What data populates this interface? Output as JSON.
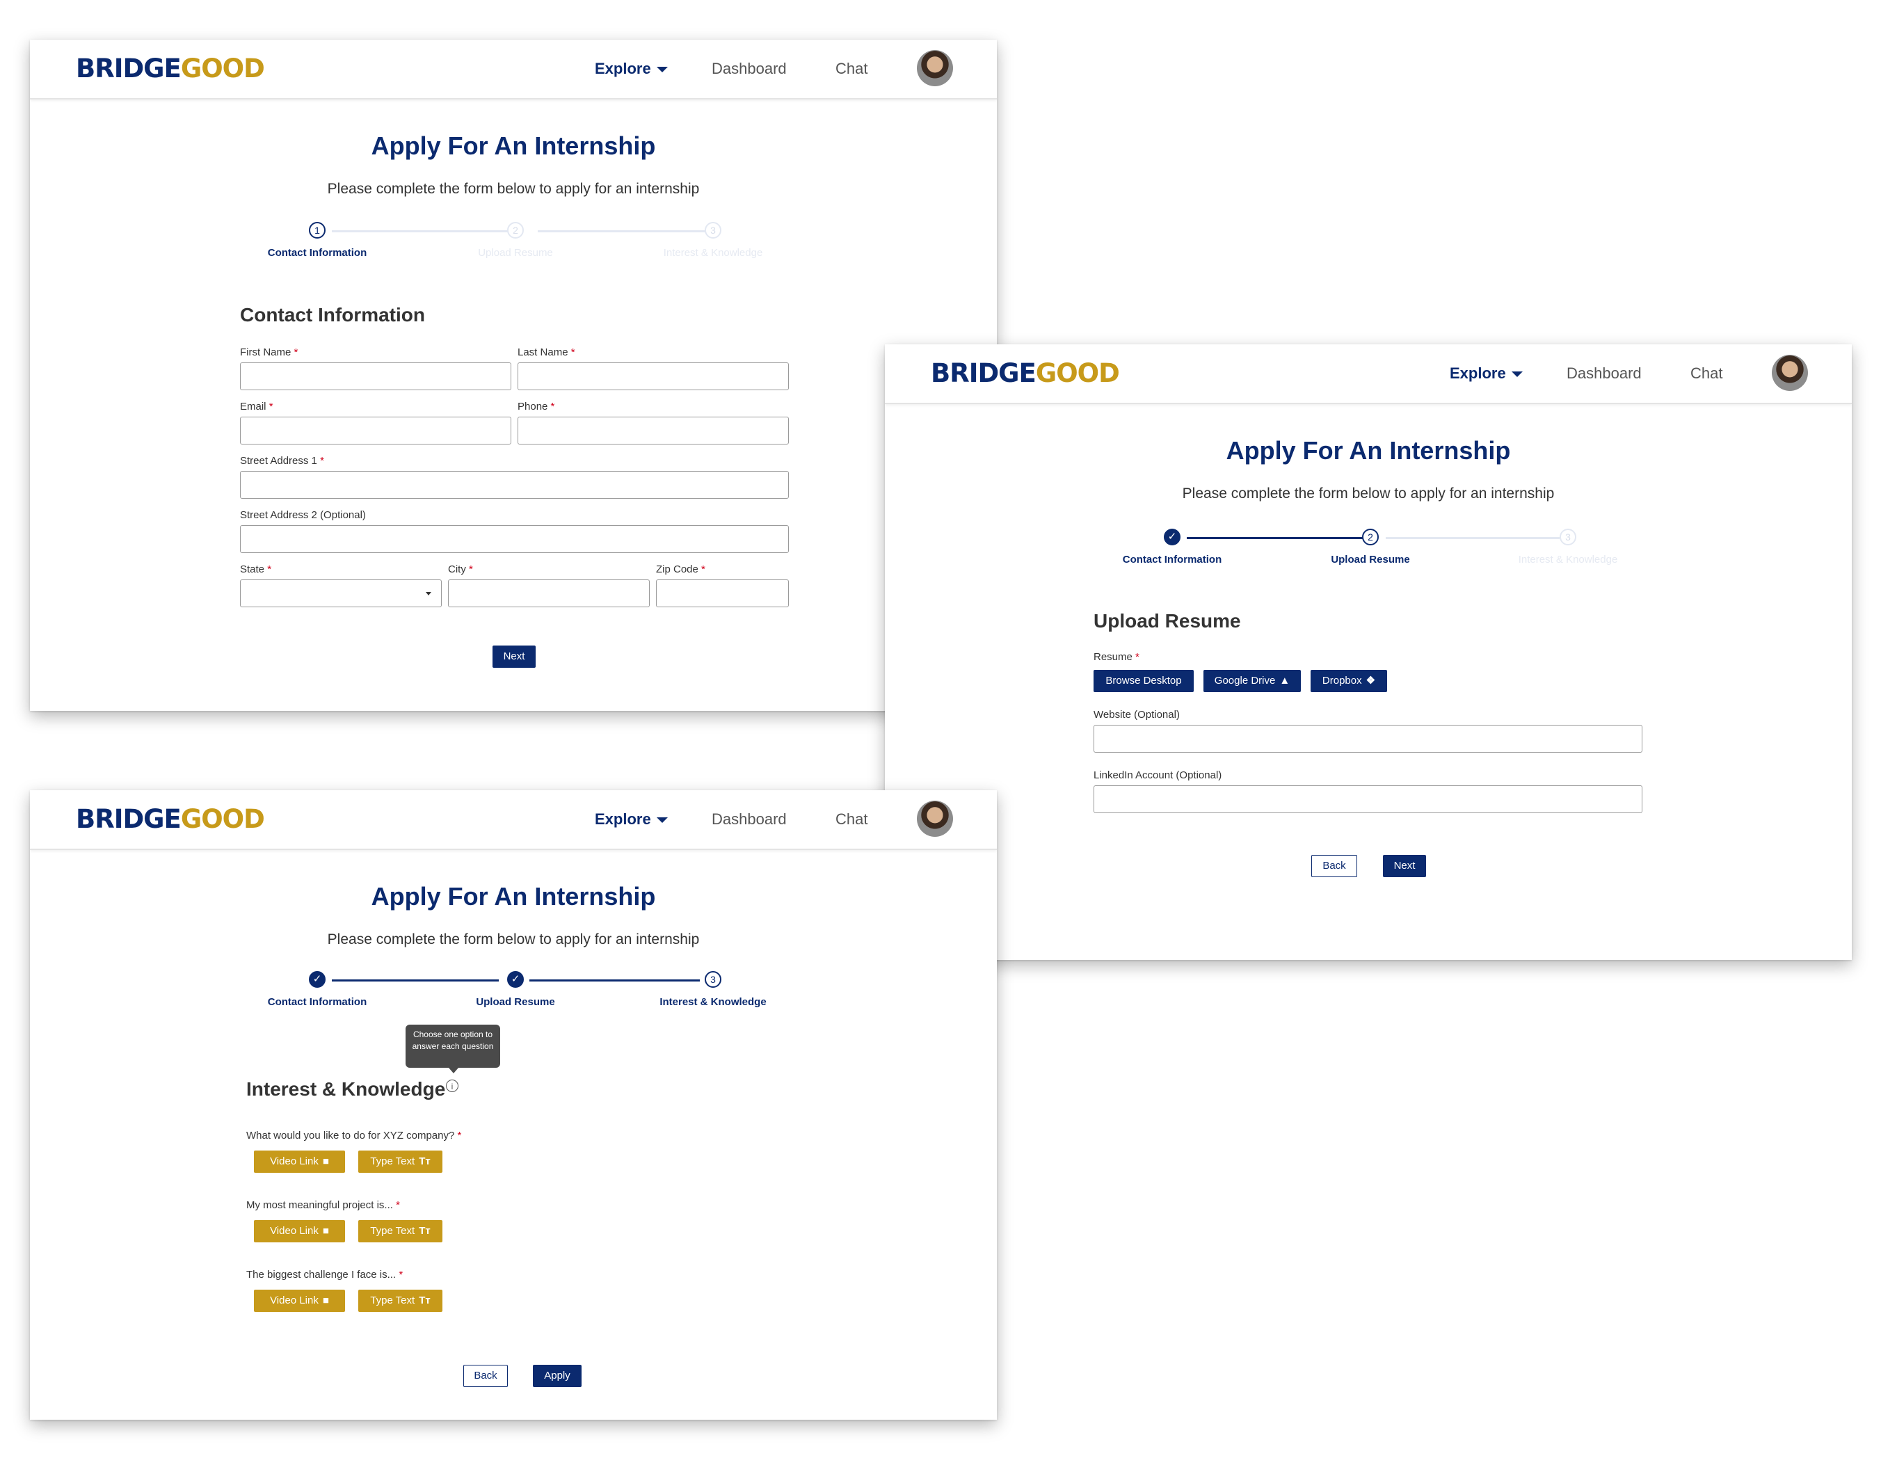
{
  "brand": {
    "part1": "BRIDGE",
    "part2": "GOOD",
    "color_primary": "#0b2a6f",
    "color_gold": "#c79a1a"
  },
  "nav": {
    "explore": "Explore",
    "dashboard": "Dashboard",
    "chat": "Chat"
  },
  "page": {
    "title": "Apply For An Internship",
    "subtitle": "Please complete the form below to apply for an internship"
  },
  "steps": {
    "s1": {
      "num": "1",
      "label": "Contact Information"
    },
    "s2": {
      "num": "2",
      "label": "Upload Resume"
    },
    "s3": {
      "num": "3",
      "label": "Interest & Knowledge"
    },
    "check": "✓"
  },
  "contact": {
    "section_title": "Contact Information",
    "first_name": "First Name",
    "last_name": "Last Name",
    "email": "Email",
    "phone": "Phone",
    "street1": "Street Address 1",
    "street2": "Street Address 2 (Optional)",
    "state": "State",
    "city": "City",
    "zip": "Zip Code",
    "required_mark": "*",
    "next_button": "Next"
  },
  "resume": {
    "section_title": "Upload Resume",
    "resume_label": "Resume",
    "browse_button": "Browse Desktop",
    "gdrive_button": "Google Drive",
    "dropbox_button": "Dropbox",
    "website_label": "Website (Optional)",
    "linkedin_label": "LinkedIn Account (Optional)",
    "back_button": "Back",
    "next_button": "Next"
  },
  "interest": {
    "section_title": "Interest & Knowledge",
    "tooltip": "Choose one option to answer each question",
    "questions": [
      "What would you like to do for XYZ company?",
      "My most meaningful project is...",
      "The biggest challenge I face is..."
    ],
    "video_button": "Video Link",
    "text_button": "Type Text",
    "back_button": "Back",
    "apply_button": "Apply"
  }
}
